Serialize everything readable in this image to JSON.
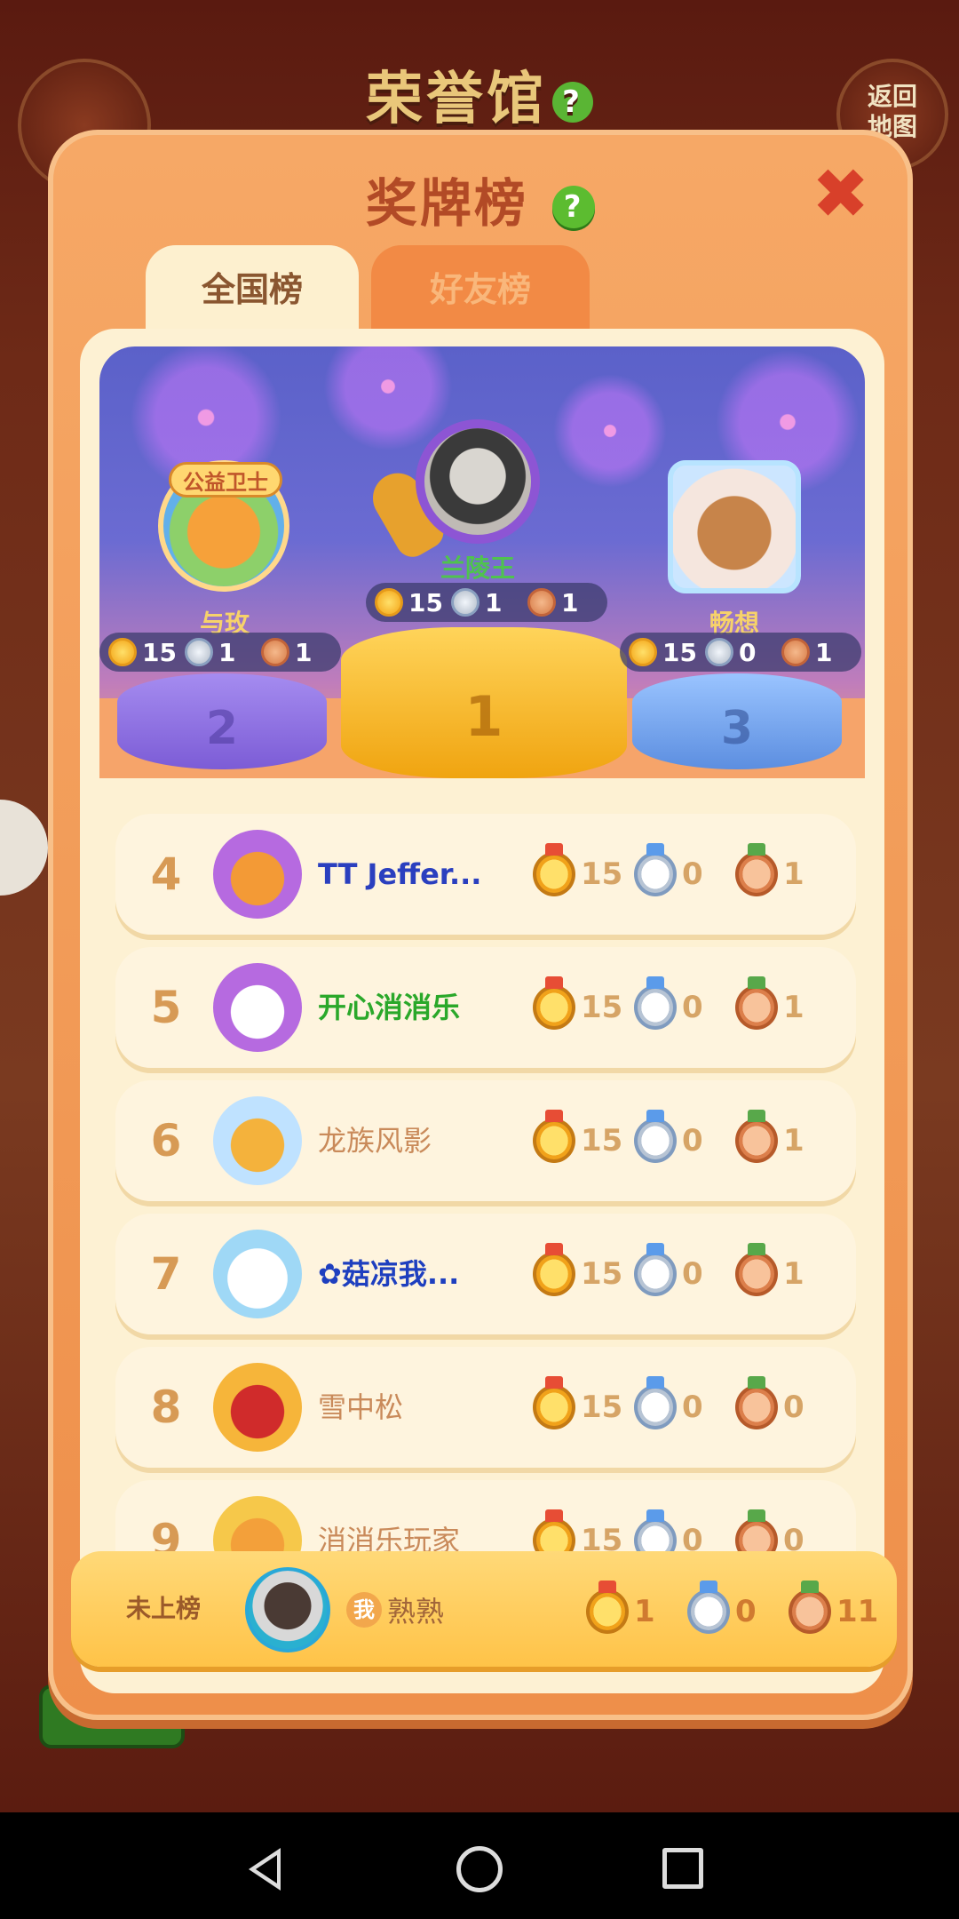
{
  "background": {
    "title": "荣誉馆",
    "help_icon_glyph": "?",
    "back_button": "返回\n地图"
  },
  "modal": {
    "title": "奖牌榜",
    "help_icon_glyph": "?",
    "close_glyph": "✖"
  },
  "tabs": [
    {
      "label": "全国榜",
      "selected": true
    },
    {
      "label": "好友榜",
      "selected": false
    }
  ],
  "podium": [
    {
      "place": "2",
      "name": "与玫",
      "gold": "15",
      "silver": "1",
      "bronze": "1",
      "badge": "公益卫士"
    },
    {
      "place": "1",
      "name": "兰陵王",
      "gold": "15",
      "silver": "1",
      "bronze": "1"
    },
    {
      "place": "3",
      "name": "畅想",
      "gold": "15",
      "silver": "0",
      "bronze": "1"
    }
  ],
  "rows": [
    {
      "rank": "4",
      "name": "TT Jeffer...",
      "gold": "15",
      "silver": "0",
      "bronze": "1",
      "name_color": "#2a3fbf"
    },
    {
      "rank": "5",
      "name": "开心消消乐",
      "gold": "15",
      "silver": "0",
      "bronze": "1",
      "name_color": "#2aa82a"
    },
    {
      "rank": "6",
      "name": "龙族风影",
      "gold": "15",
      "silver": "0",
      "bronze": "1",
      "name_color": "#c98a5a"
    },
    {
      "rank": "7",
      "name": "✿菇凉我...",
      "gold": "15",
      "silver": "0",
      "bronze": "1",
      "name_color": "#1e3fbf"
    },
    {
      "rank": "8",
      "name": "雪中松",
      "gold": "15",
      "silver": "0",
      "bronze": "0",
      "name_color": "#c98a5a"
    },
    {
      "rank": "9",
      "name": "消消乐玩家",
      "gold": "15",
      "silver": "0",
      "bronze": "0",
      "name_color": "#c98a5a"
    }
  ],
  "my_row": {
    "status": "未上榜",
    "me_tag": "我",
    "name": "熟熟",
    "gold": "1",
    "silver": "0",
    "bronze": "11"
  },
  "colors": {
    "modal_orange": "#ee8f4a",
    "gold_pedestal": "#ffd45a",
    "rank_text": "#d79a55"
  }
}
